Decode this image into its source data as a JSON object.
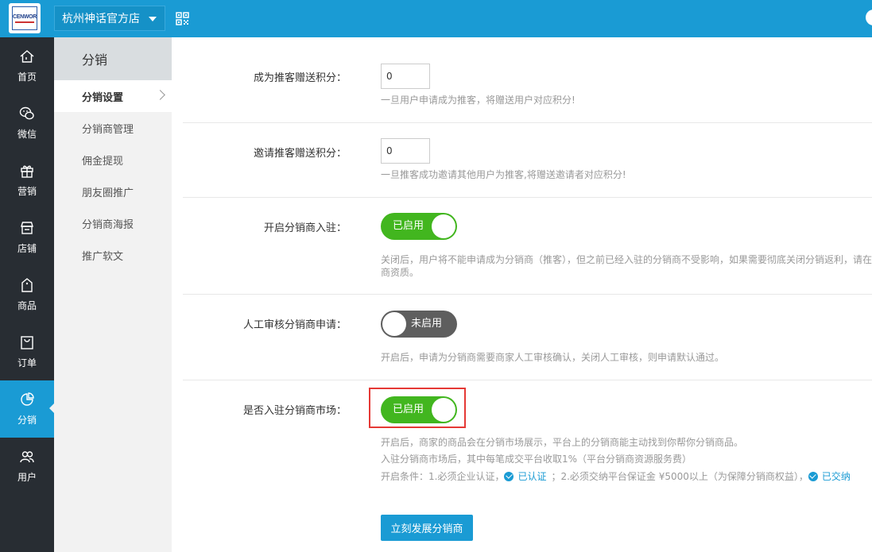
{
  "header": {
    "logo_text": "CENWOR",
    "shop_name": "杭州神话官方店"
  },
  "leftnav": {
    "items": [
      {
        "label": "首页",
        "icon": "home-icon"
      },
      {
        "label": "微信",
        "icon": "wechat-icon"
      },
      {
        "label": "营销",
        "icon": "gift-icon"
      },
      {
        "label": "店铺",
        "icon": "store-icon"
      },
      {
        "label": "商品",
        "icon": "tag-icon"
      },
      {
        "label": "订单",
        "icon": "bag-icon"
      },
      {
        "label": "分销",
        "icon": "pie-chart-icon",
        "active": true
      },
      {
        "label": "用户",
        "icon": "users-icon"
      }
    ]
  },
  "subnav": {
    "title": "分销",
    "items": [
      {
        "label": "分销设置",
        "active": true
      },
      {
        "label": "分销商管理"
      },
      {
        "label": "佣金提现"
      },
      {
        "label": "朋友圈推广"
      },
      {
        "label": "分销商海报"
      },
      {
        "label": "推广软文"
      }
    ]
  },
  "form": {
    "referral_points": {
      "label": "成为推客赠送积分：",
      "value": "0",
      "hint": "一旦用户申请成为推客，将赠送用户对应积分!"
    },
    "invite_points": {
      "label": "邀请推客赠送积分：",
      "value": "0",
      "hint": "一旦推客成功邀请其他用户为推客,将赠送邀请者对应积分!"
    },
    "open_entry": {
      "label": "开启分销商入驻：",
      "state": "已启用",
      "enabled": true,
      "hint_line1": "关闭后，用户将不能申请成为分销商（推客），但之前已经入驻的分销商不受影响，如果需要彻底关闭分销返利，请在",
      "hint_line2": "商资质。"
    },
    "manual_review": {
      "label": "人工审核分销商申请：",
      "state": "未启用",
      "enabled": false,
      "hint": "开启后，申请为分销商需要商家人工审核确认，关闭人工审核，则申请默认通过。"
    },
    "market_entry": {
      "label": "是否入驻分销商市场：",
      "state": "已启用",
      "enabled": true,
      "hint_line1": "开启后，商家的商品会在分销市场展示，平台上的分销商能主动找到你帮你分销商品。",
      "hint_line2": "入驻分销商市场后，其中每笔成交平台收取1%（平台分销商资源服务费）",
      "cond_prefix": "开启条件：1.必须企业认证，",
      "cond_badge1": "已认证",
      "cond_mid": "；2.必须交纳平台保证金 ¥5000以上（为保障分销商权益），",
      "cond_badge2": "已交纳"
    },
    "submit_label": "立刻发展分销商"
  },
  "colors": {
    "brand_blue": "#1a9bd4",
    "toggle_on": "#42b61f",
    "toggle_off": "#5e5e5e",
    "highlight_red": "#e53935",
    "sidebar_dark": "#282d33"
  }
}
